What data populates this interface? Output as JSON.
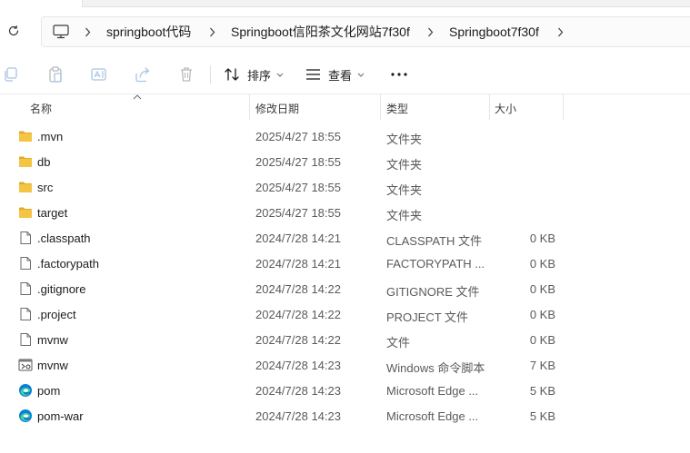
{
  "breadcrumb": [
    "springboot代码",
    "Springboot信阳茶文化网站7f30f",
    "Springboot7f30f"
  ],
  "toolbar": {
    "sort_label": "排序",
    "view_label": "查看",
    "more_label": "⋯"
  },
  "columns": {
    "name": "名称",
    "date": "修改日期",
    "type": "类型",
    "size": "大小"
  },
  "files": [
    {
      "name": ".mvn",
      "date": "2025/4/27 18:55",
      "type": "文件夹",
      "size": "",
      "icon": "folder-icon"
    },
    {
      "name": "db",
      "date": "2025/4/27 18:55",
      "type": "文件夹",
      "size": "",
      "icon": "folder-icon"
    },
    {
      "name": "src",
      "date": "2025/4/27 18:55",
      "type": "文件夹",
      "size": "",
      "icon": "folder-icon"
    },
    {
      "name": "target",
      "date": "2025/4/27 18:55",
      "type": "文件夹",
      "size": "",
      "icon": "folder-icon"
    },
    {
      "name": ".classpath",
      "date": "2024/7/28 14:21",
      "type": "CLASSPATH 文件",
      "size": "0 KB",
      "icon": "file-icon"
    },
    {
      "name": ".factorypath",
      "date": "2024/7/28 14:21",
      "type": "FACTORYPATH ...",
      "size": "0 KB",
      "icon": "file-icon"
    },
    {
      "name": ".gitignore",
      "date": "2024/7/28 14:22",
      "type": "GITIGNORE 文件",
      "size": "0 KB",
      "icon": "file-icon"
    },
    {
      "name": ".project",
      "date": "2024/7/28 14:22",
      "type": "PROJECT 文件",
      "size": "0 KB",
      "icon": "file-icon"
    },
    {
      "name": "mvnw",
      "date": "2024/7/28 14:22",
      "type": "文件",
      "size": "0 KB",
      "icon": "file-icon"
    },
    {
      "name": "mvnw",
      "date": "2024/7/28 14:23",
      "type": "Windows 命令脚本",
      "size": "7 KB",
      "icon": "cmd-script-icon"
    },
    {
      "name": "pom",
      "date": "2024/7/28 14:23",
      "type": "Microsoft Edge ...",
      "size": "5 KB",
      "icon": "edge-icon"
    },
    {
      "name": "pom-war",
      "date": "2024/7/28 14:23",
      "type": "Microsoft Edge ...",
      "size": "5 KB",
      "icon": "edge-icon"
    }
  ],
  "colors": {
    "folder": "#f4c542",
    "folder_dark": "#e0a92a",
    "accent": "#0a64c8",
    "disabled_icon": "#a9c4e4"
  }
}
